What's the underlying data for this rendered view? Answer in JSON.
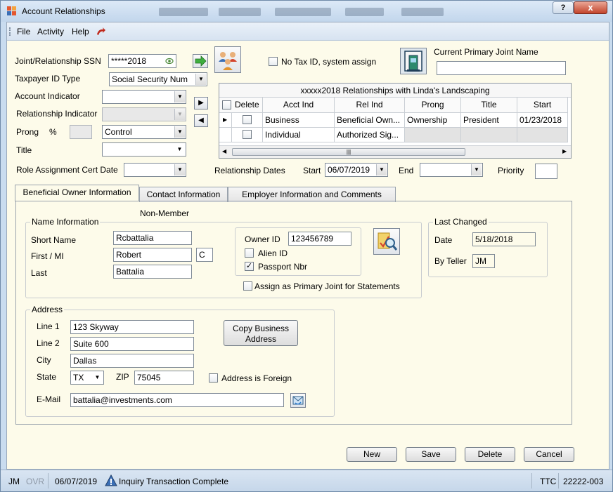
{
  "window": {
    "title": "Account Relationships",
    "help": "?",
    "close": "x"
  },
  "menu": [
    "File",
    "Activity",
    "Help"
  ],
  "form": {
    "ssn_label": "Joint/Relationship SSN",
    "ssn_value": "*****2018",
    "taxpayer_label": "Taxpayer ID Type",
    "taxpayer_value": "Social Security Num",
    "account_indicator_label": "Account Indicator",
    "account_indicator_value": "",
    "relationship_indicator_label": "Relationship Indicator",
    "relationship_indicator_value": "",
    "prong_label": "Prong",
    "percent_label": "%",
    "prong_value": "Control",
    "title_label": "Title",
    "title_value": "",
    "role_cert_label": "Role Assignment Cert Date",
    "role_cert_value": "",
    "no_tax_id_label": "No Tax ID, system assign",
    "current_primary_label": "Current Primary Joint Name",
    "current_primary_value": "",
    "relationship_dates_label": "Relationship Dates",
    "start_label": "Start",
    "start_value": "06/07/2019",
    "end_label": "End",
    "end_value": "",
    "priority_label": "Priority",
    "priority_value": ""
  },
  "grid": {
    "caption": "xxxxx2018 Relationships with Linda's Landscaping",
    "columns": [
      "Delete",
      "Acct Ind",
      "Rel Ind",
      "Prong",
      "Title",
      "Start"
    ],
    "rows": [
      {
        "acct_ind": "Business",
        "rel_ind": "Beneficial Own...",
        "prong": "Ownership",
        "title": "President",
        "start": "01/23/2018"
      },
      {
        "acct_ind": "Individual",
        "rel_ind": "Authorized Sig...",
        "prong": "",
        "title": "",
        "start": ""
      }
    ]
  },
  "tabs": [
    "Beneficial Owner Information",
    "Contact Information",
    "Employer Information and Comments"
  ],
  "name_info": {
    "group_title": "Name Information",
    "non_member": "Non-Member",
    "short_name_label": "Short Name",
    "short_name_value": "Rcbattalia",
    "first_label": "First / MI",
    "first_value": "Robert",
    "mi_value": "C",
    "last_label": "Last",
    "last_value": "Battalia",
    "owner_id_label": "Owner ID",
    "owner_id_value": "123456789",
    "alien_id_label": "Alien ID",
    "passport_label": "Passport Nbr",
    "assign_primary_label": "Assign as Primary Joint for Statements"
  },
  "last_changed": {
    "group_title": "Last Changed",
    "date_label": "Date",
    "date_value": "5/18/2018",
    "teller_label": "By Teller",
    "teller_value": "JM"
  },
  "address": {
    "group_title": "Address",
    "line1_label": "Line 1",
    "line1_value": "123 Skyway",
    "line2_label": "Line 2",
    "line2_value": "Suite 600",
    "city_label": "City",
    "city_value": "Dallas",
    "state_label": "State",
    "state_value": "TX",
    "zip_label": "ZIP",
    "zip_value": "75045",
    "foreign_label": "Address is Foreign",
    "email_label": "E-Mail",
    "email_value": "battalia@investments.com",
    "copy_business_line1": "Copy Business",
    "copy_business_line2": "Address"
  },
  "buttons": {
    "new": "New",
    "save": "Save",
    "delete": "Delete",
    "cancel": "Cancel"
  },
  "status": {
    "user": "JM",
    "ovr": "OVR",
    "date": "06/07/2019",
    "message": "Inquiry Transaction Complete",
    "ttc": "TTC",
    "code": "22222-003"
  },
  "colors": {
    "accent_green": "#3fae3f",
    "window_frame": "#c9dcef",
    "panel_bg": "#fdfbea"
  }
}
